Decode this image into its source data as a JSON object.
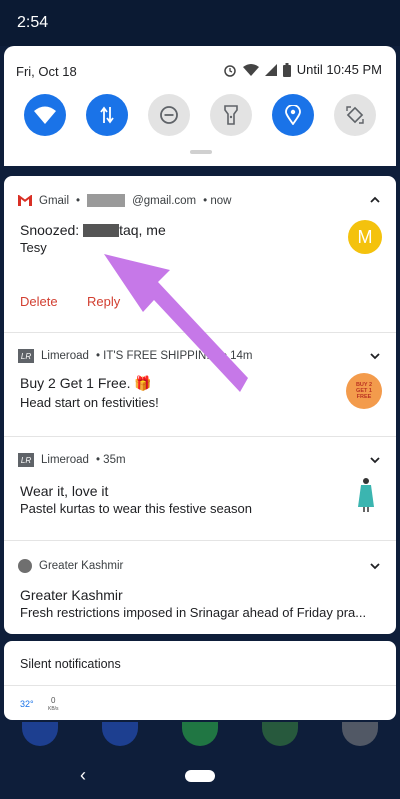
{
  "status_bar": {
    "time": "2:54"
  },
  "quick_settings": {
    "date": "Fri, Oct 18",
    "alarm_until": "Until 10:45 PM",
    "tiles": [
      {
        "name": "wifi",
        "state": "on"
      },
      {
        "name": "mobile-data",
        "state": "on"
      },
      {
        "name": "do-not-disturb",
        "state": "off"
      },
      {
        "name": "flashlight",
        "state": "off"
      },
      {
        "name": "location",
        "state": "on"
      },
      {
        "name": "auto-rotate",
        "state": "off"
      }
    ]
  },
  "notifications": [
    {
      "app": "Gmail",
      "account_suffix": "@gmail.com",
      "time": "• now",
      "title_prefix": "Snoozed:",
      "title_suffix": "taq, me",
      "text": "Tesy",
      "avatar": "M",
      "actions": [
        "Delete",
        "Reply"
      ]
    },
    {
      "app": "Limeroad",
      "extra": "• IT'S FREE SHIPPIN...",
      "time": "• 14m",
      "title": "Buy 2 Get 1 Free. 🎁",
      "text": "Head start on festivities!",
      "badge_text": "BUY 2 GET 1 FREE"
    },
    {
      "app": "Limeroad",
      "time": "• 35m",
      "title": "Wear it, love it",
      "text": "Pastel kurtas to wear this festive season"
    },
    {
      "app": "Greater Kashmir",
      "title": "Greater Kashmir",
      "text": "Fresh restrictions imposed in Srinagar ahead of Friday pra..."
    }
  ],
  "silent": {
    "label": "Silent notifications",
    "temp": "32°",
    "speed_value": "0",
    "speed_unit": "KB/s"
  },
  "icons": {
    "gmail": "gmail-icon",
    "limeroad": "limeroad-icon",
    "alarm": "alarm-icon",
    "battery": "battery-icon"
  },
  "colors": {
    "accent": "#1a73e8",
    "action_red": "#d23f31",
    "avatar_yellow": "#f4c20d",
    "arrow": "#c678e8"
  }
}
